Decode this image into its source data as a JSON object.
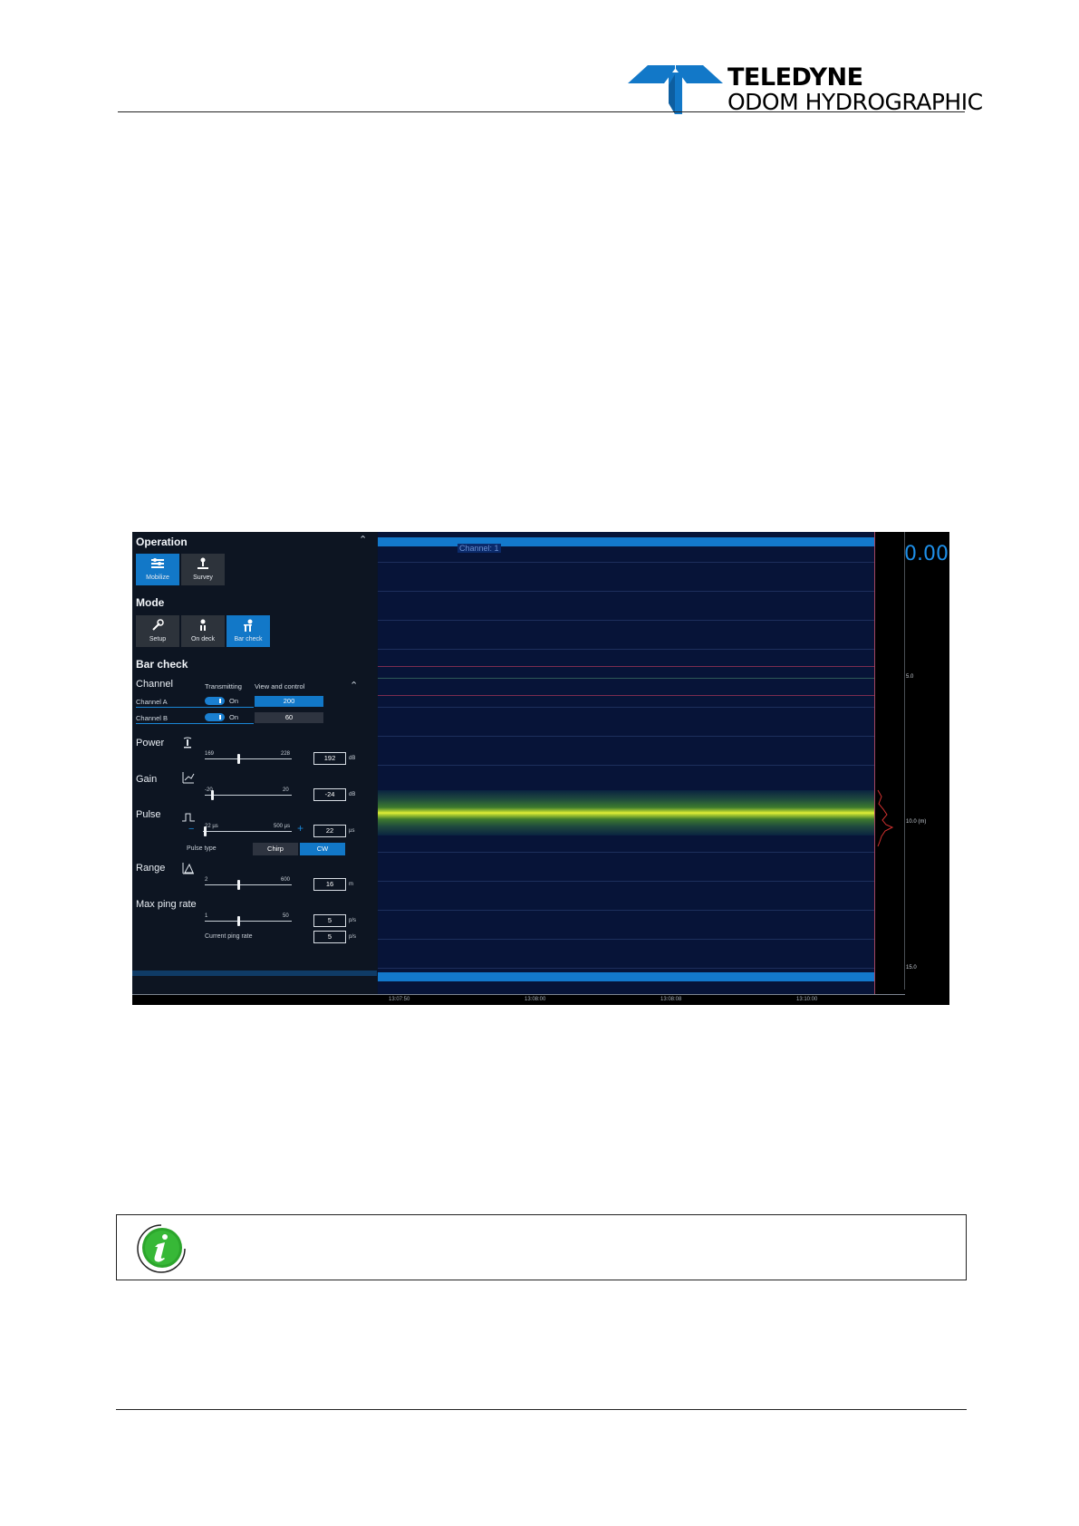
{
  "brand": {
    "line1": "TELEDYNE",
    "line2": "ODOM HYDROGRAPHIC",
    "logo_color": "#1278c8"
  },
  "screenshot": {
    "operation": {
      "title": "Operation",
      "buttons": [
        {
          "label": "Mobilize",
          "icon": "mobilize-icon",
          "active": true
        },
        {
          "label": "Survey",
          "icon": "survey-icon",
          "active": false
        }
      ]
    },
    "mode": {
      "title": "Mode",
      "buttons": [
        {
          "label": "Setup",
          "icon": "setup-icon",
          "active": false
        },
        {
          "label": "On deck",
          "icon": "on-deck-icon",
          "active": false
        },
        {
          "label": "Bar check",
          "icon": "bar-check-icon",
          "active": true
        }
      ]
    },
    "bar_check": {
      "title": "Bar check",
      "channel": {
        "label": "Channel",
        "col_transmitting": "Transmitting",
        "col_view": "View and control",
        "rows": [
          {
            "name": "Channel A",
            "state": "On",
            "value": "200",
            "selected": true
          },
          {
            "name": "Channel B",
            "state": "On",
            "value": "60",
            "selected": false
          }
        ]
      },
      "power": {
        "label": "Power",
        "min": "169",
        "max": "228",
        "value": "192",
        "unit": "dB",
        "fraction": 0.39
      },
      "gain": {
        "label": "Gain",
        "min": "-20",
        "max": "20",
        "value": "-24",
        "unit": "dB",
        "fraction": 0.08
      },
      "pulse": {
        "label": "Pulse",
        "min": "22 µs",
        "max": "500 µs",
        "value": "22",
        "unit": "µs",
        "fraction": 0.0,
        "minus": "−",
        "plus": "+",
        "type_label": "Pulse type",
        "type_options": [
          "Chirp",
          "CW"
        ],
        "type_selected": "CW"
      },
      "range": {
        "label": "Range",
        "min": "2",
        "max": "600",
        "value": "16",
        "unit": "m",
        "fraction": 0.39
      },
      "ping": {
        "label": "Max ping rate",
        "min": "1",
        "max": "50",
        "value": "5",
        "unit": "p/s",
        "fraction": 0.39,
        "current_label": "Current ping rate",
        "current_value": "5",
        "current_unit": "p/s"
      }
    },
    "echogram": {
      "channel_tag": "Channel: 1",
      "depth_value": "0.00",
      "scale_labels": [
        "5.0",
        "10.0 (m)",
        "15.0"
      ],
      "time_labels": [
        "13:07:50",
        "13:08:00",
        "13:08:08",
        "13:10:00"
      ]
    }
  },
  "note": {
    "icon": "info-icon",
    "icon_color": "#2ca52c"
  }
}
